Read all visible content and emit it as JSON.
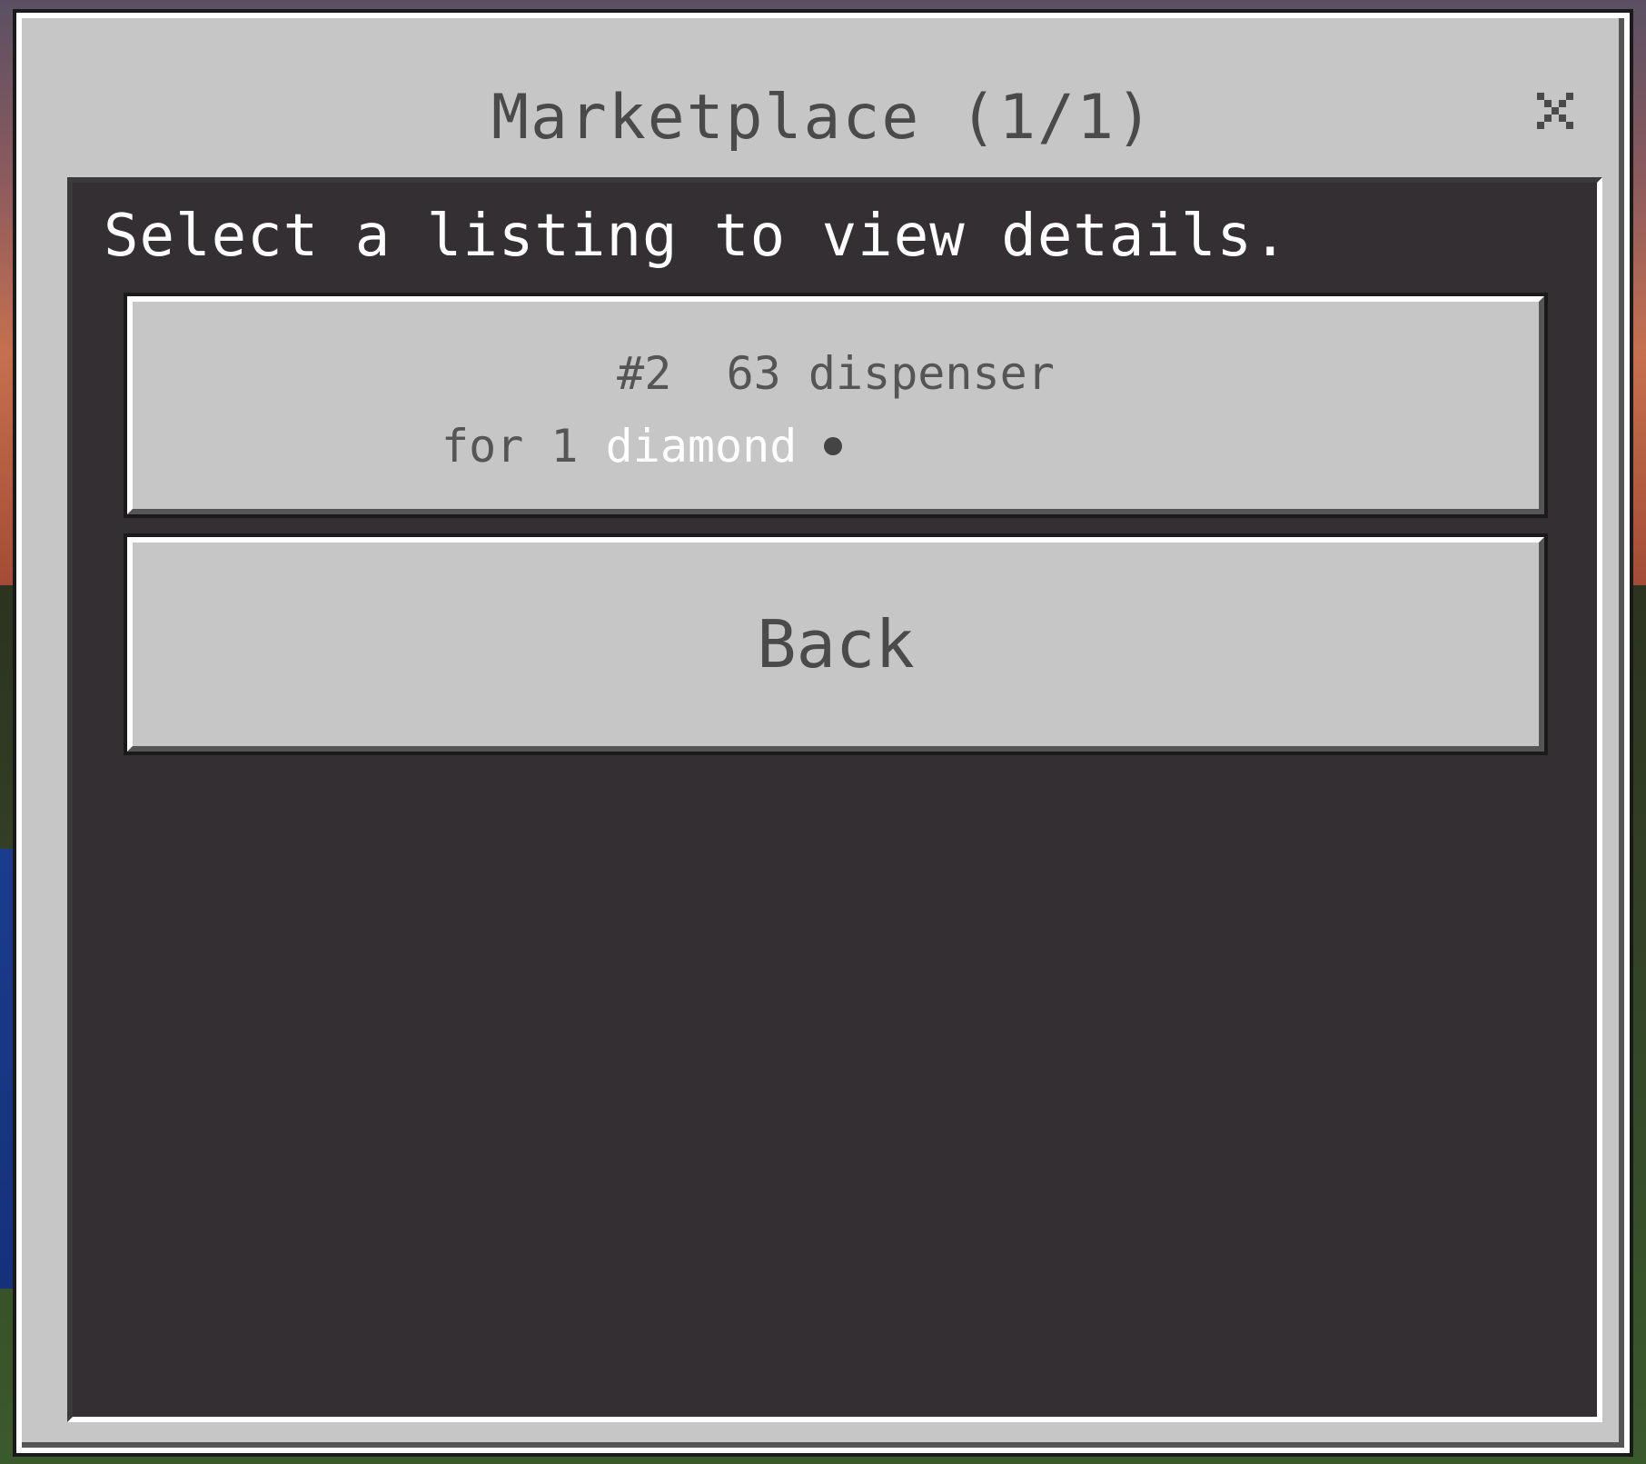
{
  "window": {
    "title": "Marketplace (1/1)"
  },
  "panel": {
    "heading": "Select a listing to view details."
  },
  "listings": [
    {
      "line1": "#2  63 dispenser",
      "price_prefix": "for 1 ",
      "price_item": "diamond",
      "icon": "diamond-icon"
    }
  ],
  "buttons": {
    "back_label": "Back",
    "close_icon": "close-icon"
  },
  "colors": {
    "window_bg": "#c6c6c6",
    "title_text": "#4a4a4a",
    "heading_text": "#ffffff",
    "item_highlight": "#ffffff"
  }
}
